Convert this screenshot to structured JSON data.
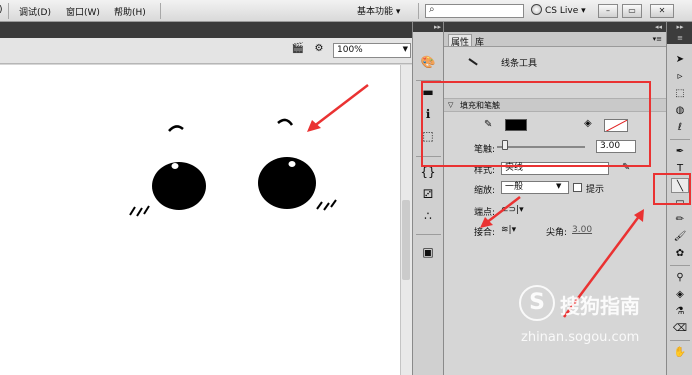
{
  "menubar": {
    "items": [
      "调试(D)",
      "窗口(W)",
      "帮助(H)"
    ],
    "workspace": "基本功能",
    "search_placeholder": "",
    "cs_live": "CS Live"
  },
  "doc_toolbar": {
    "zoom": "100%"
  },
  "properties": {
    "tab_properties": "属性",
    "tab_library": "库",
    "tool_name": "线条工具",
    "section_title": "填充和笔触",
    "stroke_label": "笔触:",
    "stroke_value": "3.00",
    "style_label": "样式:",
    "style_value": "实线",
    "scale_label": "缩放:",
    "scale_value": "一般",
    "hint_label": "提示",
    "cap_label": "端点:",
    "join_label": "接合:",
    "miter_label": "尖角:",
    "miter_value": "3.00"
  },
  "colors": {
    "stroke": "#000000",
    "fill": "none",
    "annotation": "#ea3232"
  },
  "watermark": {
    "logo": "S",
    "brand": "搜狗指南",
    "url": "zhinan.sogou.com"
  }
}
